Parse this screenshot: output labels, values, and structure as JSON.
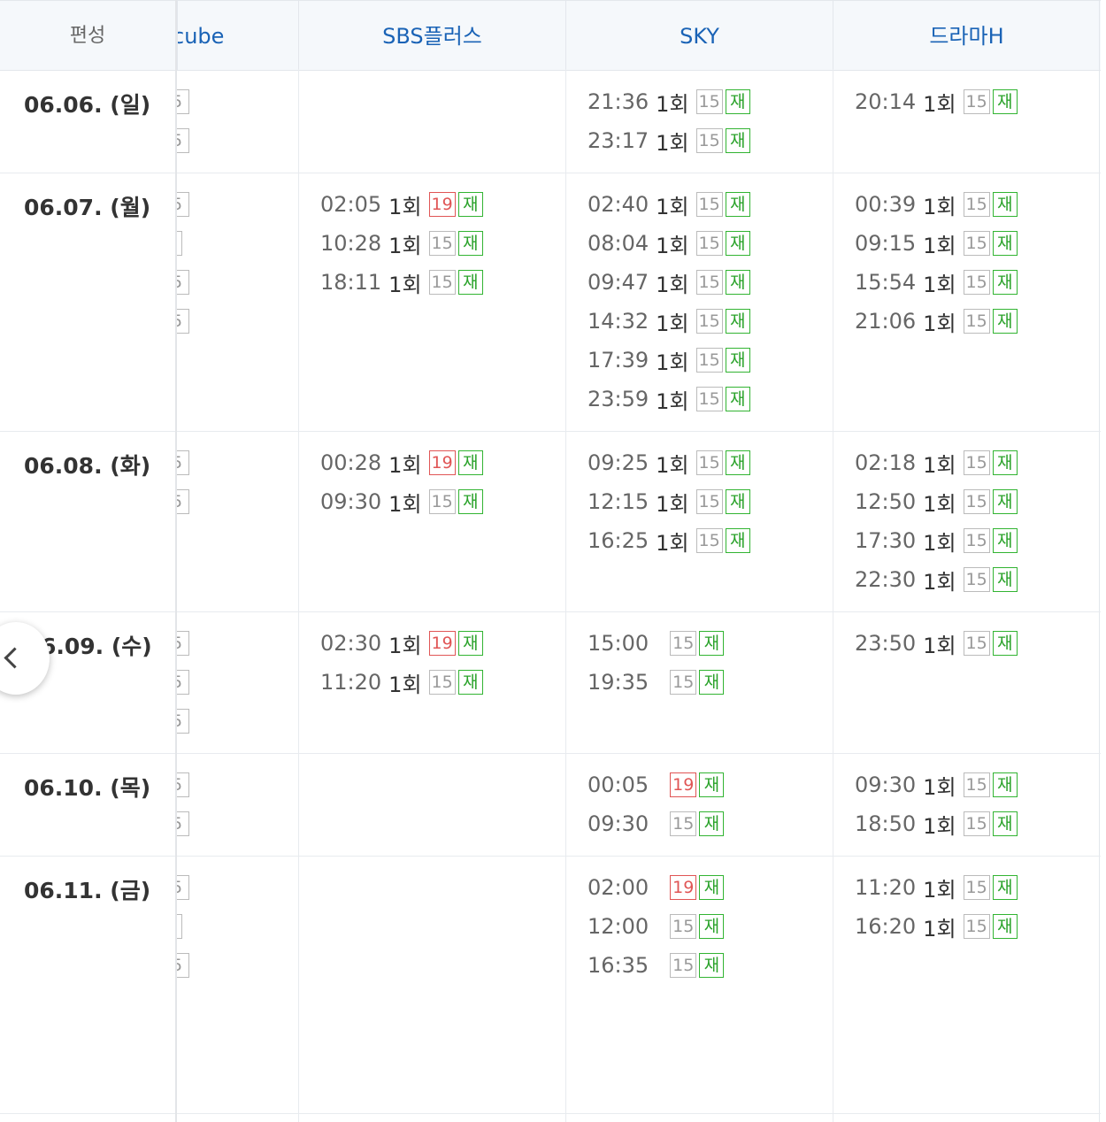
{
  "header": {
    "label": "편성",
    "channels": [
      "cube",
      "SBS플러스",
      "SKY",
      "드라마H"
    ]
  },
  "colors": {
    "channel_link": "#1a63b6",
    "rating_19": "#e05555",
    "rerun": "#2aa22a",
    "rating_15": "#999999"
  },
  "nav": {
    "prev_icon": "chevron-left-icon"
  },
  "days": [
    {
      "date": "06.06. (일)",
      "cube_stubs": [
        "5",
        "5"
      ],
      "sbs": [],
      "sky": [
        {
          "time": "21:36",
          "ep": "1회",
          "rating": "15",
          "re": "재"
        },
        {
          "time": "23:17",
          "ep": "1회",
          "rating": "15",
          "re": "재"
        }
      ],
      "dramah": [
        {
          "time": "20:14",
          "ep": "1회",
          "rating": "15",
          "re": "재"
        }
      ]
    },
    {
      "date": "06.07. (월)",
      "cube_stubs": [
        "5",
        "",
        "5",
        "5"
      ],
      "sbs": [
        {
          "time": "02:05",
          "ep": "1회",
          "rating": "19",
          "re": "재"
        },
        {
          "time": "10:28",
          "ep": "1회",
          "rating": "15",
          "re": "재"
        },
        {
          "time": "18:11",
          "ep": "1회",
          "rating": "15",
          "re": "재"
        }
      ],
      "sky": [
        {
          "time": "02:40",
          "ep": "1회",
          "rating": "15",
          "re": "재"
        },
        {
          "time": "08:04",
          "ep": "1회",
          "rating": "15",
          "re": "재"
        },
        {
          "time": "09:47",
          "ep": "1회",
          "rating": "15",
          "re": "재"
        },
        {
          "time": "14:32",
          "ep": "1회",
          "rating": "15",
          "re": "재"
        },
        {
          "time": "17:39",
          "ep": "1회",
          "rating": "15",
          "re": "재"
        },
        {
          "time": "23:59",
          "ep": "1회",
          "rating": "15",
          "re": "재"
        }
      ],
      "dramah": [
        {
          "time": "00:39",
          "ep": "1회",
          "rating": "15",
          "re": "재"
        },
        {
          "time": "09:15",
          "ep": "1회",
          "rating": "15",
          "re": "재"
        },
        {
          "time": "15:54",
          "ep": "1회",
          "rating": "15",
          "re": "재"
        },
        {
          "time": "21:06",
          "ep": "1회",
          "rating": "15",
          "re": "재"
        }
      ]
    },
    {
      "date": "06.08. (화)",
      "cube_stubs": [
        "5",
        "5"
      ],
      "sbs": [
        {
          "time": "00:28",
          "ep": "1회",
          "rating": "19",
          "re": "재"
        },
        {
          "time": "09:30",
          "ep": "1회",
          "rating": "15",
          "re": "재"
        }
      ],
      "sky": [
        {
          "time": "09:25",
          "ep": "1회",
          "rating": "15",
          "re": "재"
        },
        {
          "time": "12:15",
          "ep": "1회",
          "rating": "15",
          "re": "재"
        },
        {
          "time": "16:25",
          "ep": "1회",
          "rating": "15",
          "re": "재"
        }
      ],
      "dramah": [
        {
          "time": "02:18",
          "ep": "1회",
          "rating": "15",
          "re": "재"
        },
        {
          "time": "12:50",
          "ep": "1회",
          "rating": "15",
          "re": "재"
        },
        {
          "time": "17:30",
          "ep": "1회",
          "rating": "15",
          "re": "재"
        },
        {
          "time": "22:30",
          "ep": "1회",
          "rating": "15",
          "re": "재"
        }
      ]
    },
    {
      "date": "6.09. (수)",
      "cube_stubs": [
        "5",
        "5",
        "5"
      ],
      "sbs": [
        {
          "time": "02:30",
          "ep": "1회",
          "rating": "19",
          "re": "재"
        },
        {
          "time": "11:20",
          "ep": "1회",
          "rating": "15",
          "re": "재"
        }
      ],
      "sky": [
        {
          "time": "15:00",
          "ep": "",
          "rating": "15",
          "re": "재"
        },
        {
          "time": "19:35",
          "ep": "",
          "rating": "15",
          "re": "재"
        }
      ],
      "dramah": [
        {
          "time": "23:50",
          "ep": "1회",
          "rating": "15",
          "re": "재"
        }
      ]
    },
    {
      "date": "06.10. (목)",
      "cube_stubs": [
        "5",
        "5"
      ],
      "sbs": [],
      "sky": [
        {
          "time": "00:05",
          "ep": "",
          "rating": "19",
          "re": "재"
        },
        {
          "time": "09:30",
          "ep": "",
          "rating": "15",
          "re": "재"
        }
      ],
      "dramah": [
        {
          "time": "09:30",
          "ep": "1회",
          "rating": "15",
          "re": "재"
        },
        {
          "time": "18:50",
          "ep": "1회",
          "rating": "15",
          "re": "재"
        }
      ]
    },
    {
      "date": "06.11. (금)",
      "cube_stubs": [
        "5",
        "",
        "5"
      ],
      "sbs": [],
      "sky": [
        {
          "time": "02:00",
          "ep": "",
          "rating": "19",
          "re": "재"
        },
        {
          "time": "12:00",
          "ep": "",
          "rating": "15",
          "re": "재"
        },
        {
          "time": "16:35",
          "ep": "",
          "rating": "15",
          "re": "재"
        }
      ],
      "dramah": [
        {
          "time": "11:20",
          "ep": "1회",
          "rating": "15",
          "re": "재"
        },
        {
          "time": "16:20",
          "ep": "1회",
          "rating": "15",
          "re": "재"
        }
      ]
    }
  ]
}
